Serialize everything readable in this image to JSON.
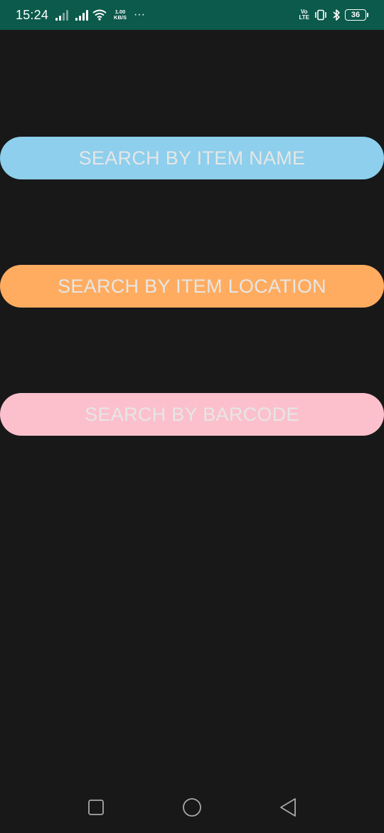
{
  "status_bar": {
    "time": "15:24",
    "network_speed_value": "1.00",
    "network_speed_unit": "KB/S",
    "more_indicator": "···",
    "volte_top": "Vo",
    "volte_bottom": "LTE",
    "battery_level": "36",
    "icons": [
      "signal-1-icon",
      "signal-2-icon",
      "wifi-icon",
      "volte-icon",
      "vibrate-icon",
      "bluetooth-icon",
      "battery-icon"
    ]
  },
  "buttons": [
    {
      "label": "SEARCH BY ITEM NAME",
      "color": "#8dcfec"
    },
    {
      "label": "SEARCH BY ITEM LOCATION",
      "color": "#ffac60"
    },
    {
      "label": "SEARCH BY BARCODE",
      "color": "#fbc0cc"
    }
  ],
  "nav_bar": {
    "icons": [
      "recent-apps-icon",
      "home-icon",
      "back-icon"
    ]
  },
  "colors": {
    "background": "#181818",
    "status_bar": "#0b5a4b",
    "button_text": "#e6e6e6"
  }
}
